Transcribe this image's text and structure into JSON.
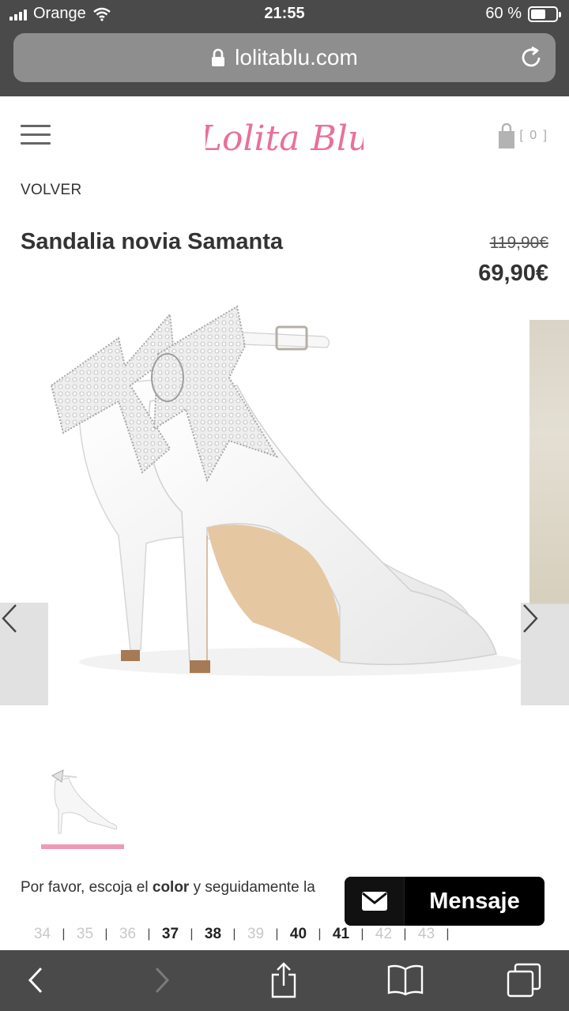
{
  "status_bar": {
    "carrier": "Orange",
    "time": "21:55",
    "battery": "60 %",
    "battery_level": 0.6
  },
  "browser": {
    "url": "lolitablu.com",
    "lock_icon": "lock-icon",
    "reload_icon": "reload-icon"
  },
  "header": {
    "logo_text": "Lolita Blu",
    "menu_icon": "hamburger-icon",
    "cart_count": "[ 0 ]",
    "cart_icon": "shopping-bag-icon"
  },
  "nav": {
    "back_link": "VOLVER"
  },
  "product": {
    "title": "Sandalia novia Samanta",
    "old_price": "119,90€",
    "new_price": "69,90€"
  },
  "gallery": {
    "prev_icon": "chevron-left-icon",
    "next_icon": "chevron-right-icon"
  },
  "selection": {
    "text_prefix": "Por favor, escoja el ",
    "text_bold": "color",
    "text_suffix": " y seguidamente la",
    "sizes": [
      {
        "label": "34",
        "available": false
      },
      {
        "label": "35",
        "available": false
      },
      {
        "label": "36",
        "available": false
      },
      {
        "label": "37",
        "available": true
      },
      {
        "label": "38",
        "available": true
      },
      {
        "label": "39",
        "available": false
      },
      {
        "label": "40",
        "available": true
      },
      {
        "label": "41",
        "available": true
      },
      {
        "label": "42",
        "available": false
      },
      {
        "label": "43",
        "available": false
      }
    ]
  },
  "chat": {
    "label": "Mensaje",
    "icon": "envelope-icon"
  },
  "toolbar": {
    "back_icon": "chevron-left-icon",
    "forward_icon": "chevron-right-icon",
    "share_icon": "share-icon",
    "bookmarks_icon": "book-icon",
    "tabs_icon": "tabs-icon"
  },
  "colors": {
    "brand_pink": "#e9709a",
    "accent_bar": "#ef9ab5",
    "chrome": "#4a4a4a"
  }
}
